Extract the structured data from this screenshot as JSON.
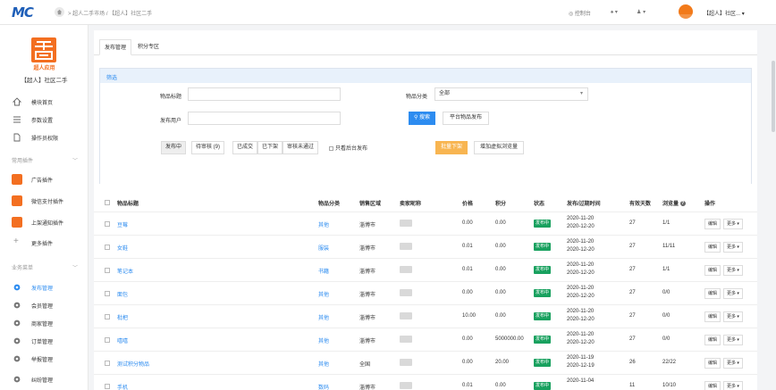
{
  "header": {
    "logo": "MC",
    "breadcrumb": "> 超人二手市场 / 【超人】社区二手",
    "console": "控制台",
    "bell_caret": "▾",
    "user_caret": "▾",
    "account": "【超人】社区...",
    "account_caret": "▾"
  },
  "sidebar": {
    "app_name": "超人应用",
    "app_title": "【超人】社区二手",
    "items_top": [
      {
        "label": "模块首页",
        "icon": "home-icon"
      },
      {
        "label": "参数设置",
        "icon": "list-icon"
      },
      {
        "label": "操作员权限",
        "icon": "file-icon"
      }
    ],
    "section_plugins": "常用插件",
    "plugins": [
      {
        "label": "广告插件"
      },
      {
        "label": "微信支付插件"
      },
      {
        "label": "上架通知插件"
      }
    ],
    "more_plugins": "更多插件",
    "section_business": "业务菜单",
    "business": [
      {
        "label": "发布管理",
        "active": true
      },
      {
        "label": "会员管理"
      },
      {
        "label": "商家管理"
      },
      {
        "label": "订单管理"
      },
      {
        "label": "举报管理"
      },
      {
        "label": "纠纷管理"
      }
    ]
  },
  "tabs": [
    "发布管理",
    "积分专区"
  ],
  "filter": {
    "title": "筛选",
    "label_item_title": "物品标题",
    "label_category": "物品分类",
    "category_value": "全部",
    "label_user": "发布用户",
    "search_btn": "搜索",
    "platform_btn": "平台物品发布",
    "status_tabs": [
      "发布中",
      "待审核 (9)",
      "已成交",
      "已下架",
      "审核未通过"
    ],
    "only_backend": "只看后台发布",
    "batch_off": "批量下架",
    "add_views": "增加虚拟浏览量"
  },
  "table": {
    "headers": [
      "物品标题",
      "物品分类",
      "销售区域",
      "卖家昵称",
      "价格",
      "积分",
      "状态",
      "发布/过期时间",
      "有效天数",
      "浏览量",
      "操作"
    ],
    "info_icon": "?",
    "edit_label": "编辑",
    "more_label": "更多 ▾",
    "rows": [
      {
        "title": "豆莓",
        "category": "其他",
        "region": "淄博市",
        "price": "0.00",
        "points": "0.00",
        "status": "发布中",
        "publish": "2020-11-20",
        "expire": "2020-12-20",
        "days": "27",
        "views": "1/1"
      },
      {
        "title": "女鞋",
        "category": "服装",
        "region": "淄博市",
        "price": "0.01",
        "points": "0.00",
        "status": "发布中",
        "publish": "2020-11-20",
        "expire": "2020-12-20",
        "days": "27",
        "views": "11/11"
      },
      {
        "title": "笔记本",
        "category": "书籍",
        "region": "淄博市",
        "price": "0.01",
        "points": "0.00",
        "status": "发布中",
        "publish": "2020-11-20",
        "expire": "2020-12-20",
        "days": "27",
        "views": "1/1"
      },
      {
        "title": "面包",
        "category": "其他",
        "region": "淄博市",
        "price": "0.00",
        "points": "0.00",
        "status": "发布中",
        "publish": "2020-11-20",
        "expire": "2020-12-20",
        "days": "27",
        "views": "0/0"
      },
      {
        "title": "枇杷",
        "category": "其他",
        "region": "淄博市",
        "price": "10.00",
        "points": "0.00",
        "status": "发布中",
        "publish": "2020-11-20",
        "expire": "2020-12-20",
        "days": "27",
        "views": "0/0"
      },
      {
        "title": "嘻嘻",
        "category": "其他",
        "region": "淄博市",
        "price": "0.00",
        "points": "5000000.00",
        "status": "发布中",
        "publish": "2020-11-20",
        "expire": "2020-12-20",
        "days": "27",
        "views": "0/0"
      },
      {
        "title": "测试积分物品",
        "category": "其他",
        "region": "全国",
        "price": "0.00",
        "points": "20.00",
        "status": "发布中",
        "publish": "2020-11-19",
        "expire": "2020-12-19",
        "days": "26",
        "views": "22/22"
      },
      {
        "title": "手机",
        "category": "数码",
        "region": "淄博市",
        "price": "0.01",
        "points": "0.00",
        "status": "发布中",
        "publish": "2020-11-04",
        "expire": "",
        "days": "11",
        "views": "10/10"
      }
    ]
  },
  "colors": {
    "accent": "#2d8cf0",
    "brand": "#f36f21",
    "status_green": "#19a15f",
    "batch_orange": "#f8b551"
  }
}
